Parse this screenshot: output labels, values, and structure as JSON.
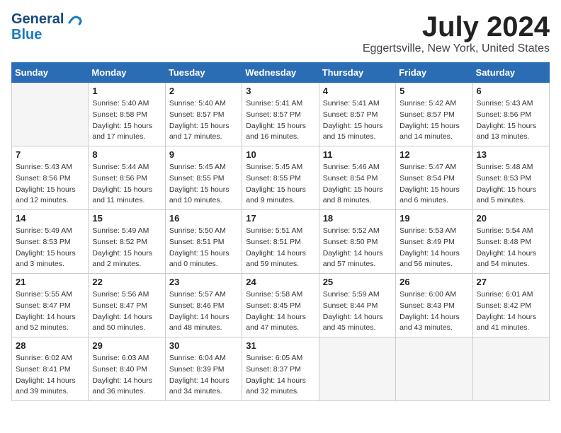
{
  "header": {
    "logo_line1": "General",
    "logo_line2": "Blue",
    "month_title": "July 2024",
    "location": "Eggertsville, New York, United States"
  },
  "days_of_week": [
    "Sunday",
    "Monday",
    "Tuesday",
    "Wednesday",
    "Thursday",
    "Friday",
    "Saturday"
  ],
  "weeks": [
    [
      {
        "day": "",
        "info": ""
      },
      {
        "day": "1",
        "info": "Sunrise: 5:40 AM\nSunset: 8:58 PM\nDaylight: 15 hours\nand 17 minutes."
      },
      {
        "day": "2",
        "info": "Sunrise: 5:40 AM\nSunset: 8:57 PM\nDaylight: 15 hours\nand 17 minutes."
      },
      {
        "day": "3",
        "info": "Sunrise: 5:41 AM\nSunset: 8:57 PM\nDaylight: 15 hours\nand 16 minutes."
      },
      {
        "day": "4",
        "info": "Sunrise: 5:41 AM\nSunset: 8:57 PM\nDaylight: 15 hours\nand 15 minutes."
      },
      {
        "day": "5",
        "info": "Sunrise: 5:42 AM\nSunset: 8:57 PM\nDaylight: 15 hours\nand 14 minutes."
      },
      {
        "day": "6",
        "info": "Sunrise: 5:43 AM\nSunset: 8:56 PM\nDaylight: 15 hours\nand 13 minutes."
      }
    ],
    [
      {
        "day": "7",
        "info": "Sunrise: 5:43 AM\nSunset: 8:56 PM\nDaylight: 15 hours\nand 12 minutes."
      },
      {
        "day": "8",
        "info": "Sunrise: 5:44 AM\nSunset: 8:56 PM\nDaylight: 15 hours\nand 11 minutes."
      },
      {
        "day": "9",
        "info": "Sunrise: 5:45 AM\nSunset: 8:55 PM\nDaylight: 15 hours\nand 10 minutes."
      },
      {
        "day": "10",
        "info": "Sunrise: 5:45 AM\nSunset: 8:55 PM\nDaylight: 15 hours\nand 9 minutes."
      },
      {
        "day": "11",
        "info": "Sunrise: 5:46 AM\nSunset: 8:54 PM\nDaylight: 15 hours\nand 8 minutes."
      },
      {
        "day": "12",
        "info": "Sunrise: 5:47 AM\nSunset: 8:54 PM\nDaylight: 15 hours\nand 6 minutes."
      },
      {
        "day": "13",
        "info": "Sunrise: 5:48 AM\nSunset: 8:53 PM\nDaylight: 15 hours\nand 5 minutes."
      }
    ],
    [
      {
        "day": "14",
        "info": "Sunrise: 5:49 AM\nSunset: 8:53 PM\nDaylight: 15 hours\nand 3 minutes."
      },
      {
        "day": "15",
        "info": "Sunrise: 5:49 AM\nSunset: 8:52 PM\nDaylight: 15 hours\nand 2 minutes."
      },
      {
        "day": "16",
        "info": "Sunrise: 5:50 AM\nSunset: 8:51 PM\nDaylight: 15 hours\nand 0 minutes."
      },
      {
        "day": "17",
        "info": "Sunrise: 5:51 AM\nSunset: 8:51 PM\nDaylight: 14 hours\nand 59 minutes."
      },
      {
        "day": "18",
        "info": "Sunrise: 5:52 AM\nSunset: 8:50 PM\nDaylight: 14 hours\nand 57 minutes."
      },
      {
        "day": "19",
        "info": "Sunrise: 5:53 AM\nSunset: 8:49 PM\nDaylight: 14 hours\nand 56 minutes."
      },
      {
        "day": "20",
        "info": "Sunrise: 5:54 AM\nSunset: 8:48 PM\nDaylight: 14 hours\nand 54 minutes."
      }
    ],
    [
      {
        "day": "21",
        "info": "Sunrise: 5:55 AM\nSunset: 8:47 PM\nDaylight: 14 hours\nand 52 minutes."
      },
      {
        "day": "22",
        "info": "Sunrise: 5:56 AM\nSunset: 8:47 PM\nDaylight: 14 hours\nand 50 minutes."
      },
      {
        "day": "23",
        "info": "Sunrise: 5:57 AM\nSunset: 8:46 PM\nDaylight: 14 hours\nand 48 minutes."
      },
      {
        "day": "24",
        "info": "Sunrise: 5:58 AM\nSunset: 8:45 PM\nDaylight: 14 hours\nand 47 minutes."
      },
      {
        "day": "25",
        "info": "Sunrise: 5:59 AM\nSunset: 8:44 PM\nDaylight: 14 hours\nand 45 minutes."
      },
      {
        "day": "26",
        "info": "Sunrise: 6:00 AM\nSunset: 8:43 PM\nDaylight: 14 hours\nand 43 minutes."
      },
      {
        "day": "27",
        "info": "Sunrise: 6:01 AM\nSunset: 8:42 PM\nDaylight: 14 hours\nand 41 minutes."
      }
    ],
    [
      {
        "day": "28",
        "info": "Sunrise: 6:02 AM\nSunset: 8:41 PM\nDaylight: 14 hours\nand 39 minutes."
      },
      {
        "day": "29",
        "info": "Sunrise: 6:03 AM\nSunset: 8:40 PM\nDaylight: 14 hours\nand 36 minutes."
      },
      {
        "day": "30",
        "info": "Sunrise: 6:04 AM\nSunset: 8:39 PM\nDaylight: 14 hours\nand 34 minutes."
      },
      {
        "day": "31",
        "info": "Sunrise: 6:05 AM\nSunset: 8:37 PM\nDaylight: 14 hours\nand 32 minutes."
      },
      {
        "day": "",
        "info": ""
      },
      {
        "day": "",
        "info": ""
      },
      {
        "day": "",
        "info": ""
      }
    ]
  ]
}
